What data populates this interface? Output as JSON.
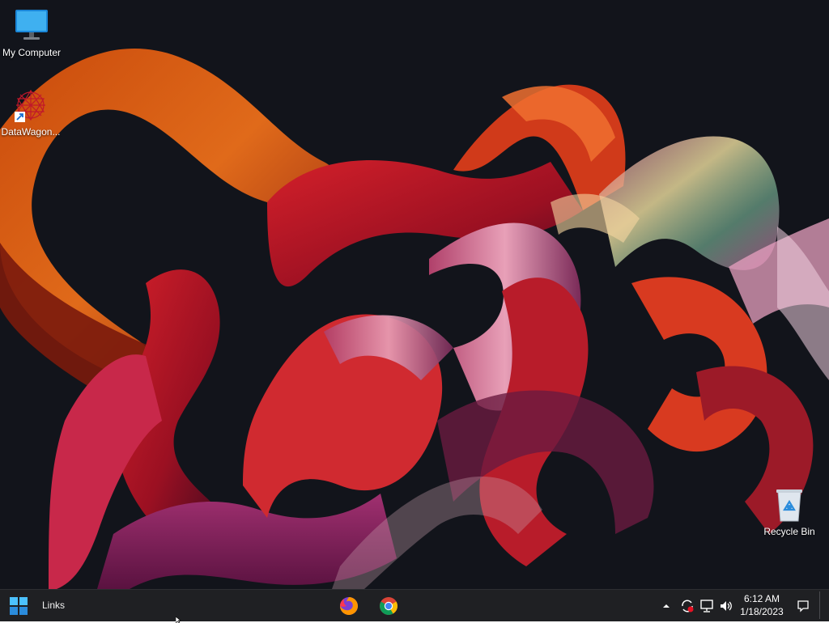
{
  "desktop": {
    "icons": [
      {
        "label": "My Computer",
        "icon": "monitor-icon"
      },
      {
        "label": "DataWagon...",
        "icon": "datawagon-app-icon",
        "shortcut": true
      },
      {
        "label": "Recycle Bin",
        "icon": "recycle-bin-icon"
      }
    ]
  },
  "taskbar": {
    "start_icon": "windows-logo-icon",
    "links_label": "Links",
    "pinned_apps": [
      {
        "name": "Firefox",
        "icon": "firefox-icon"
      },
      {
        "name": "Chrome",
        "icon": "chrome-icon"
      }
    ],
    "tray": {
      "icons": [
        "chevron-up-icon",
        "sync-icon",
        "network-icon",
        "volume-icon"
      ],
      "time": "6:12 AM",
      "date": "1/18/2023",
      "notification_icon": "notification-icon"
    }
  },
  "colors": {
    "taskbar_bg": "#1f2023",
    "desktop_bg": "#12141b",
    "accent_blue": "#2b8cdc"
  }
}
